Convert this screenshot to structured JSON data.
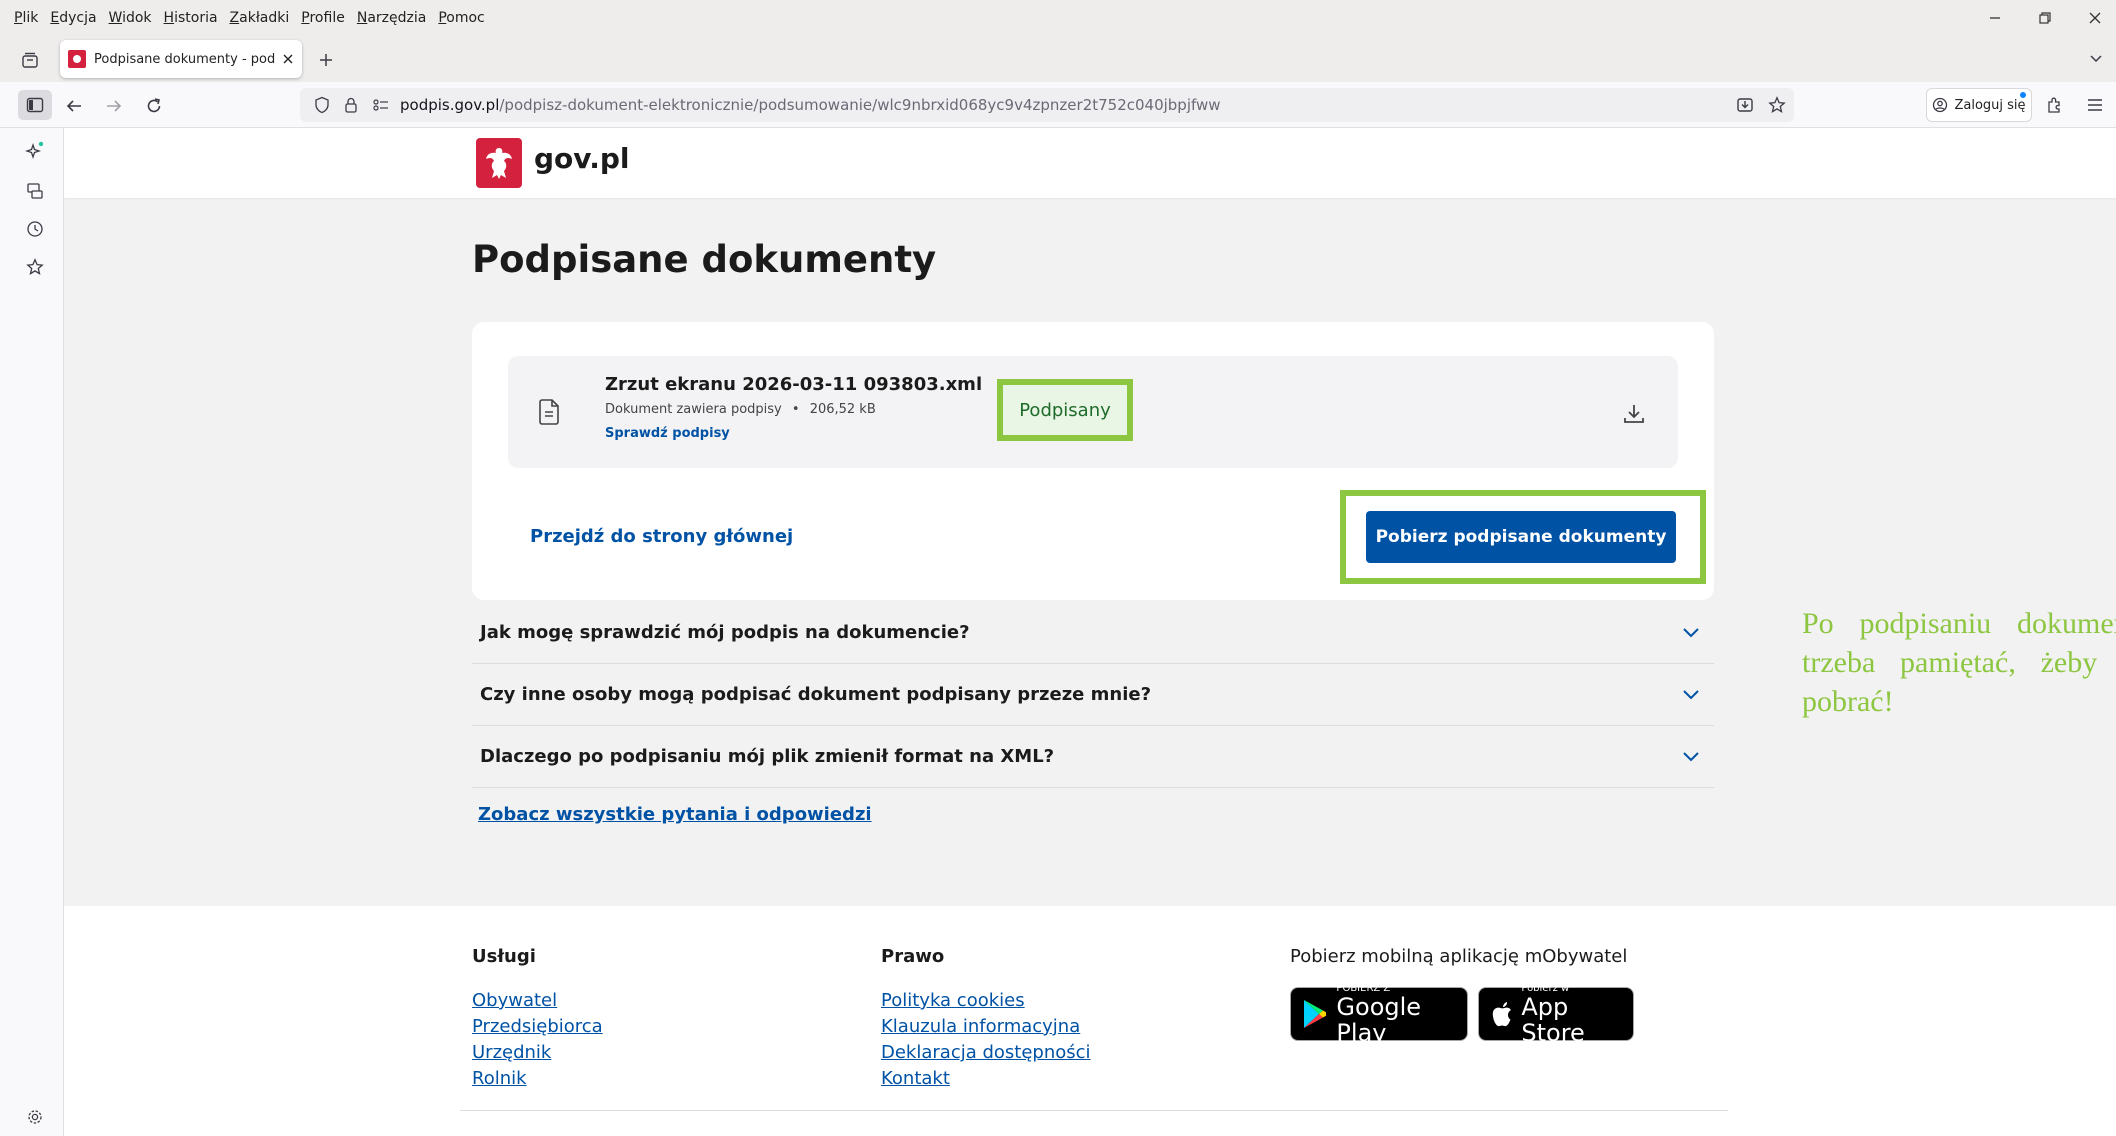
{
  "browser": {
    "menu": [
      "Plik",
      "Edycja",
      "Widok",
      "Historia",
      "Zakładki",
      "Profile",
      "Narzędzia",
      "Pomoc"
    ],
    "tab_title": "Podpisane dokumenty - podpis",
    "url_domain": "podpis.gov.pl",
    "url_path": "/podpisz-dokument-elektronicznie/podsumowanie/wlc9nbrxid068yc9v4zpnzer2t752c040jbpjfww",
    "signin_label": "Zaloguj się"
  },
  "site": {
    "logo_text": "gov.pl"
  },
  "main": {
    "title": "Podpisane dokumenty",
    "file": {
      "name": "Zrzut ekranu 2026-03-11 093803.xml",
      "meta": "Dokument zawiera podpisy",
      "size": "206,52 kB",
      "check_link": "Sprawdź podpisy",
      "status": "Podpisany"
    },
    "home_link": "Przejdź do strony głównej",
    "download_button": "Pobierz podpisane dokumenty"
  },
  "annotation": "Po podpisaniu dokumentu trzeba pamiętać, żeby go pobrać!",
  "faq": {
    "items": [
      "Jak mogę sprawdzić mój podpis na dokumencie?",
      "Czy inne osoby mogą podpisać dokument podpisany przeze mnie?",
      "Dlaczego po podpisaniu mój plik zmienił format na XML?"
    ],
    "all_link": "Zobacz wszystkie pytania i odpowiedzi"
  },
  "footer": {
    "services": {
      "title": "Usługi",
      "links": [
        "Obywatel",
        "Przedsiębiorca",
        "Urzędnik",
        "Rolnik"
      ]
    },
    "law": {
      "title": "Prawo",
      "links": [
        "Polityka cookies",
        "Klauzula informacyjna",
        "Deklaracja dostępności",
        "Kontakt"
      ]
    },
    "app": {
      "title": "Pobierz mobilną aplikację mObywatel",
      "google_small": "POBIERZ Z",
      "google_big": "Google Play",
      "apple_small": "Pobierz w",
      "apple_big": "App Store"
    }
  },
  "colors": {
    "accent_blue": "#0052a5",
    "highlight_green": "#8dc641",
    "gov_red": "#d4213d"
  }
}
